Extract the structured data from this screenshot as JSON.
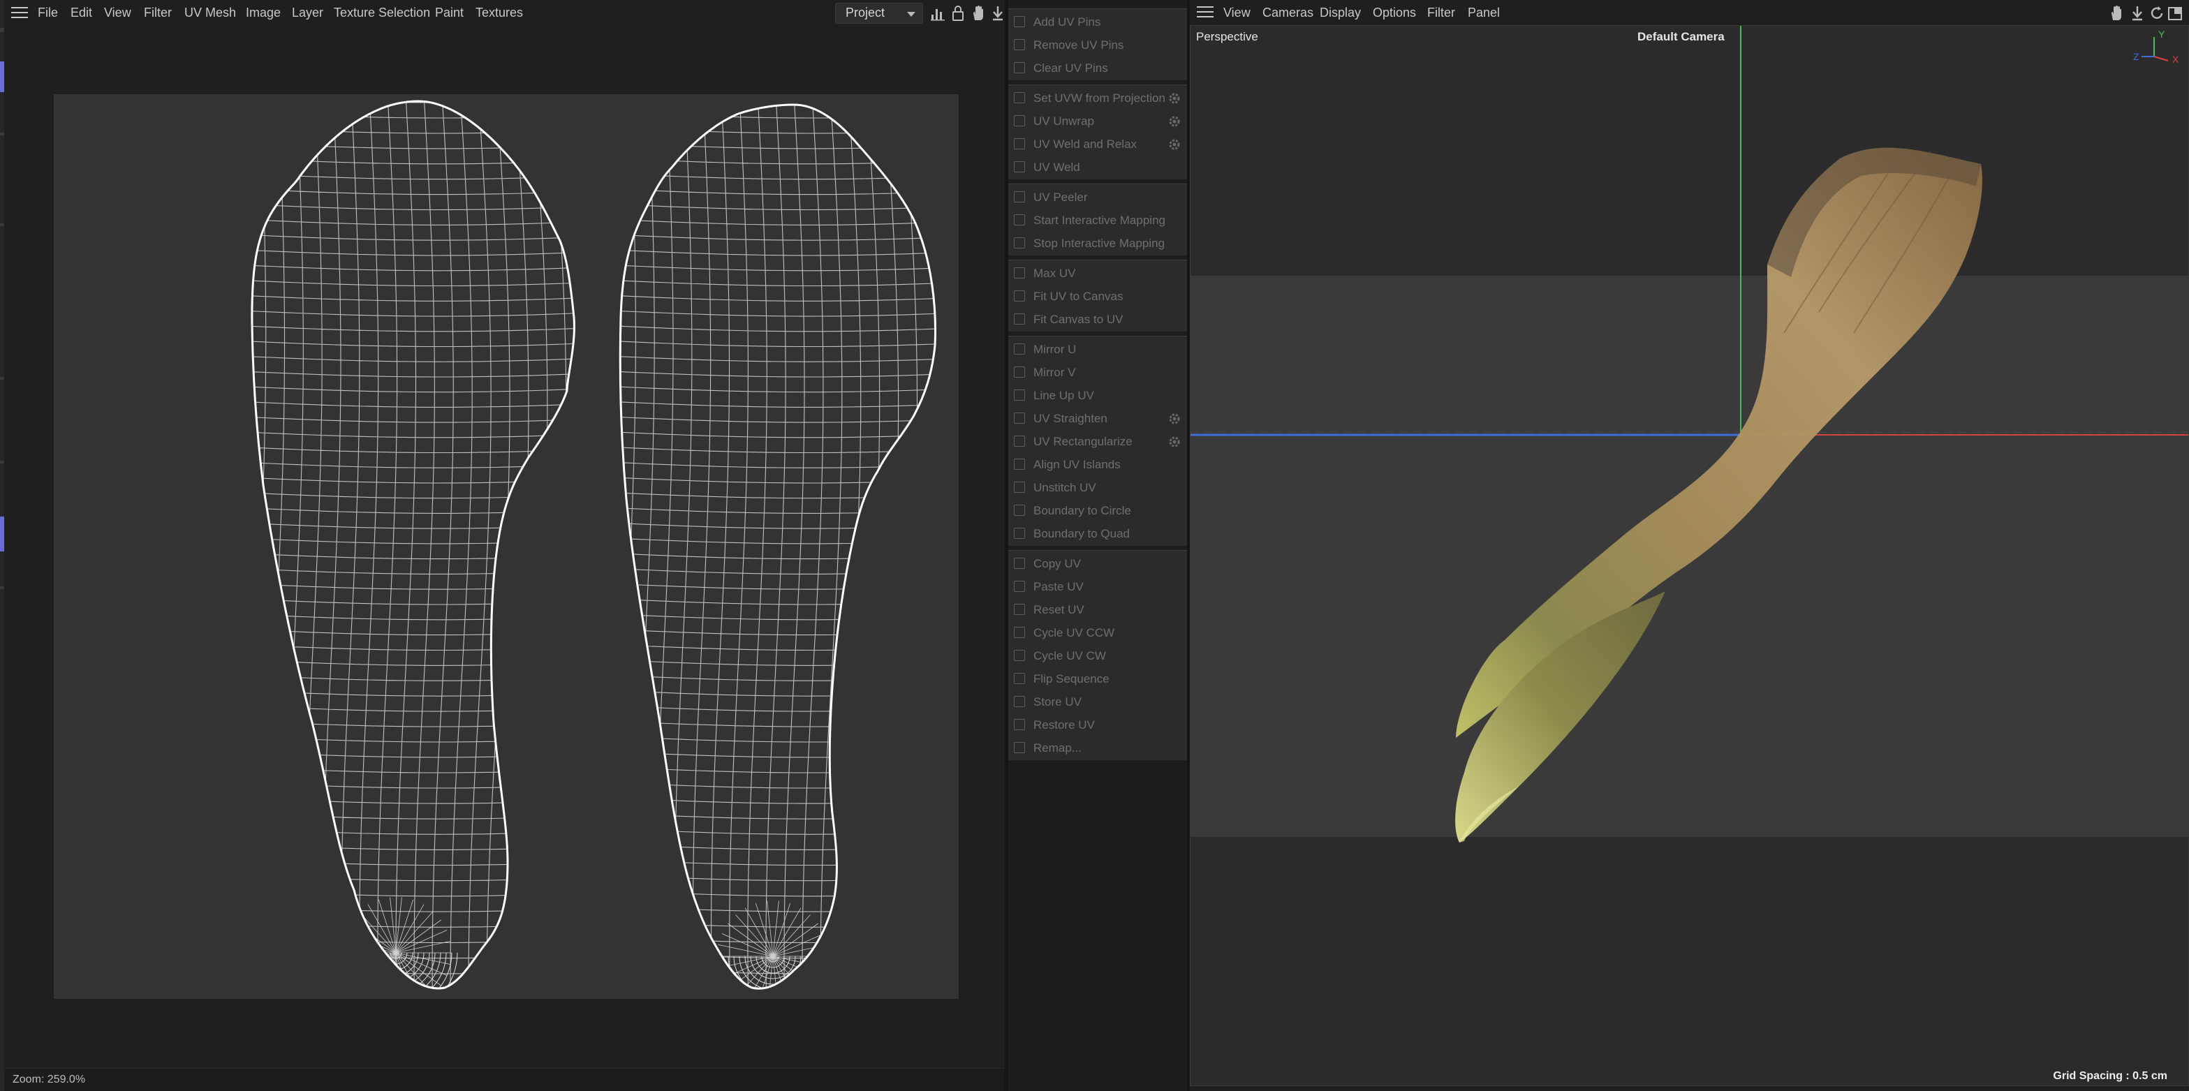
{
  "uv_editor": {
    "menu": [
      "File",
      "Edit",
      "View",
      "Filter",
      "UV Mesh",
      "Image",
      "Layer",
      "Texture Selection",
      "Paint",
      "Textures"
    ],
    "project_select": "Project",
    "zoom_label": "Zoom: 259.0%"
  },
  "palette": {
    "groups": [
      {
        "items": [
          {
            "label": "Add UV Pins",
            "icon": "pin-add-icon",
            "gear": false
          },
          {
            "label": "Remove UV Pins",
            "icon": "pin-remove-icon",
            "gear": false
          },
          {
            "label": "Clear UV Pins",
            "icon": "pin-clear-icon",
            "gear": false
          }
        ]
      },
      {
        "items": [
          {
            "label": "Set UVW from Projection",
            "icon": "projection-icon",
            "gear": true
          },
          {
            "label": "UV Unwrap",
            "icon": "unwrap-icon",
            "gear": true
          },
          {
            "label": "UV Weld and Relax",
            "icon": "weld-relax-icon",
            "gear": true
          },
          {
            "label": "UV Weld",
            "icon": "weld-icon",
            "gear": false
          }
        ]
      },
      {
        "items": [
          {
            "label": "UV Peeler",
            "icon": "peeler-icon",
            "gear": false
          },
          {
            "label": "Start Interactive Mapping",
            "icon": "play-icon",
            "gear": false
          },
          {
            "label": "Stop Interactive Mapping",
            "icon": "stop-icon",
            "gear": false
          }
        ]
      },
      {
        "items": [
          {
            "label": "Max UV",
            "icon": "max-uv-icon",
            "gear": false
          },
          {
            "label": "Fit UV to Canvas",
            "icon": "fit-uv-icon",
            "gear": false
          },
          {
            "label": "Fit Canvas to UV",
            "icon": "fit-canvas-icon",
            "gear": false
          }
        ]
      },
      {
        "items": [
          {
            "label": "Mirror U",
            "icon": "mirror-u-icon",
            "gear": false
          },
          {
            "label": "Mirror V",
            "icon": "mirror-v-icon",
            "gear": false
          },
          {
            "label": "Line Up UV",
            "icon": "line-up-icon",
            "gear": false
          },
          {
            "label": "UV Straighten",
            "icon": "straighten-icon",
            "gear": true
          },
          {
            "label": "UV Rectangularize",
            "icon": "rectangularize-icon",
            "gear": true
          },
          {
            "label": "Align UV Islands",
            "icon": "align-icon",
            "gear": false
          },
          {
            "label": "Unstitch UV",
            "icon": "unstitch-icon",
            "gear": false
          },
          {
            "label": "Boundary to Circle",
            "icon": "circle-icon",
            "gear": false
          },
          {
            "label": "Boundary to Quad",
            "icon": "quad-icon",
            "gear": false
          }
        ]
      },
      {
        "items": [
          {
            "label": "Copy UV",
            "icon": "copy-icon",
            "gear": false
          },
          {
            "label": "Paste UV",
            "icon": "paste-icon",
            "gear": false
          },
          {
            "label": "Reset UV",
            "icon": "reset-icon",
            "gear": false
          },
          {
            "label": "Cycle UV CCW",
            "icon": "cycle-ccw-icon",
            "gear": false
          },
          {
            "label": "Cycle UV CW",
            "icon": "cycle-cw-icon",
            "gear": false
          },
          {
            "label": "Flip Sequence",
            "icon": "flip-icon",
            "gear": false
          },
          {
            "label": "Store UV",
            "icon": "store-icon",
            "gear": false
          },
          {
            "label": "Restore UV",
            "icon": "restore-icon",
            "gear": false
          },
          {
            "label": "Remap...",
            "icon": "remap-icon",
            "gear": false
          }
        ]
      }
    ]
  },
  "viewport": {
    "menu": [
      "View",
      "Cameras",
      "Display",
      "Options",
      "Filter",
      "Panel"
    ],
    "view_label": "Perspective",
    "camera_label": "Default Camera",
    "grid_spacing": "Grid Spacing : 0.5 cm",
    "axis_labels": {
      "y": "Y",
      "z": "Z",
      "x": "X"
    }
  },
  "colors": {
    "axis_x": "#d94040",
    "axis_y": "#3fbf5f",
    "axis_z": "#3f6fd9",
    "wire": "#e8e8e8",
    "uv_bg": "#333333"
  }
}
